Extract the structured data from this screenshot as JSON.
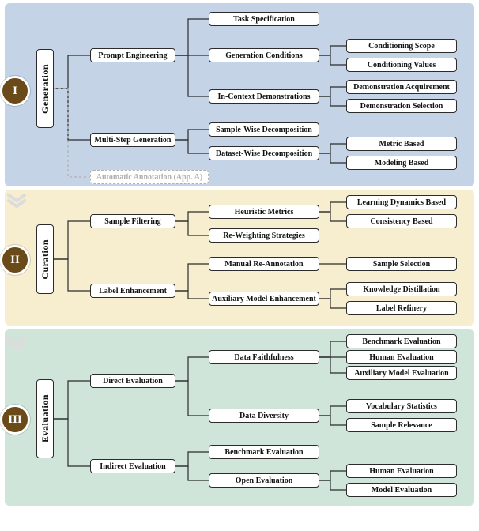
{
  "chart_data": {
    "type": "diagram",
    "sections": [
      {
        "id": "I",
        "title": "Generation",
        "children": [
          {
            "label": "Prompt Engineering",
            "children": [
              {
                "label": "Task Specification"
              },
              {
                "label": "Generation Conditions",
                "children": [
                  {
                    "label": "Conditioning Scope"
                  },
                  {
                    "label": "Conditioning Values"
                  }
                ]
              },
              {
                "label": "In-Context Demonstrations",
                "children": [
                  {
                    "label": "Demonstration Acquirement"
                  },
                  {
                    "label": "Demonstration Selection"
                  }
                ]
              }
            ]
          },
          {
            "label": "Multi-Step Generation",
            "children": [
              {
                "label": "Sample-Wise Decomposition"
              },
              {
                "label": "Dataset-Wise Decomposition",
                "children": [
                  {
                    "label": "Metric Based"
                  },
                  {
                    "label": "Modeling Based"
                  }
                ]
              }
            ]
          },
          {
            "label": "Automatic Annotation (App. A)",
            "ghost": true
          }
        ]
      },
      {
        "id": "II",
        "title": "Curation",
        "children": [
          {
            "label": "Sample Filtering",
            "children": [
              {
                "label": "Heuristic Metrics",
                "children": [
                  {
                    "label": "Learning Dynamics Based"
                  },
                  {
                    "label": "Consistency Based"
                  }
                ]
              },
              {
                "label": "Re-Weighting Strategies"
              }
            ]
          },
          {
            "label": "Label Enhancement",
            "children": [
              {
                "label": "Manual Re-Annotation",
                "children": [
                  {
                    "label": "Sample Selection"
                  }
                ]
              },
              {
                "label": "Auxiliary Model Enhancement",
                "children": [
                  {
                    "label": "Knowledge Distillation"
                  },
                  {
                    "label": "Label Refinery"
                  }
                ]
              }
            ]
          }
        ]
      },
      {
        "id": "III",
        "title": "Evaluation",
        "children": [
          {
            "label": "Direct Evaluation",
            "children": [
              {
                "label": "Data Faithfulness",
                "children": [
                  {
                    "label": "Benchmark Evaluation"
                  },
                  {
                    "label": "Human Evaluation"
                  },
                  {
                    "label": "Auxiliary Model Evaluation"
                  }
                ]
              },
              {
                "label": "Data Diversity",
                "children": [
                  {
                    "label": "Vocabulary Statistics"
                  },
                  {
                    "label": "Sample Relevance"
                  }
                ]
              }
            ]
          },
          {
            "label": "Indirect Evaluation",
            "children": [
              {
                "label": "Benchmark Evaluation"
              },
              {
                "label": "Open Evaluation",
                "children": [
                  {
                    "label": "Human Evaluation"
                  },
                  {
                    "label": "Model Evaluation"
                  }
                ]
              }
            ]
          }
        ]
      }
    ]
  },
  "sections": {
    "gen": {
      "badge": "I",
      "title": "Generation"
    },
    "cur": {
      "badge": "II",
      "title": "Curation"
    },
    "eval": {
      "badge": "III",
      "title": "Evaluation"
    }
  },
  "nodes": {
    "g_pe": "Prompt Engineering",
    "g_ts": "Task Specification",
    "g_gc": "Generation Conditions",
    "g_cs": "Conditioning Scope",
    "g_cv": "Conditioning Values",
    "g_icd": "In-Context Demonstrations",
    "g_da": "Demonstration Acquirement",
    "g_ds": "Demonstration Selection",
    "g_msg": "Multi-Step Generation",
    "g_swd": "Sample-Wise Decomposition",
    "g_dwd": "Dataset-Wise Decomposition",
    "g_mb": "Metric Based",
    "g_mob": "Modeling Based",
    "g_aa": "Automatic Annotation (App. A)",
    "c_sf": "Sample Filtering",
    "c_hm": "Heuristic Metrics",
    "c_ldb": "Learning Dynamics Based",
    "c_cb": "Consistency Based",
    "c_rws": "Re-Weighting Strategies",
    "c_le": "Label Enhancement",
    "c_mra": "Manual Re-Annotation",
    "c_ss": "Sample Selection",
    "c_ame": "Auxiliary Model Enhancement",
    "c_kd": "Knowledge Distillation",
    "c_lr": "Label Refinery",
    "e_de": "Direct Evaluation",
    "e_df": "Data Faithfulness",
    "e_be1": "Benchmark Evaluation",
    "e_he1": "Human Evaluation",
    "e_ame": "Auxiliary Model Evaluation",
    "e_dd": "Data Diversity",
    "e_vs": "Vocabulary Statistics",
    "e_sr": "Sample Relevance",
    "e_ie": "Indirect Evaluation",
    "e_be2": "Benchmark Evaluation",
    "e_oe": "Open Evaluation",
    "e_he2": "Human Evaluation",
    "e_me": "Model Evaluation"
  }
}
